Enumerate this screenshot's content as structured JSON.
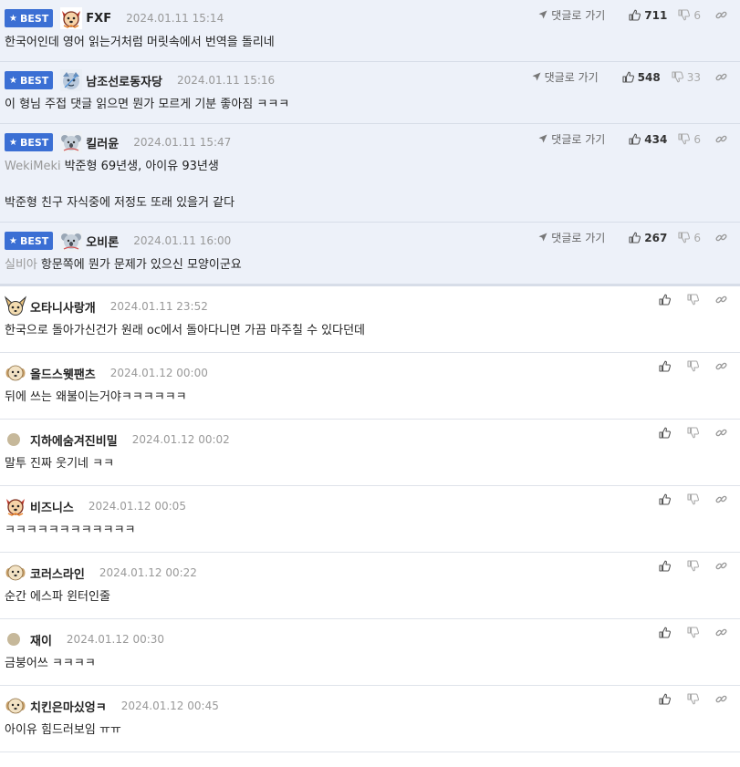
{
  "labels": {
    "best": "BEST",
    "reply": "댓글로 가기"
  },
  "best_comments": [
    {
      "nick": "FXF",
      "date": "2024.01.11 15:14",
      "likes": "711",
      "dislikes": "6",
      "avatar": "red-dog",
      "prefix": "",
      "lines": [
        "한국어인데 영어 읽는거처럼 머릿속에서 번역을 돌리네"
      ]
    },
    {
      "nick": "남조선로동자당",
      "date": "2024.01.11 15:16",
      "likes": "548",
      "dislikes": "33",
      "avatar": "blue-face",
      "prefix": "",
      "lines": [
        "이 형님 주접 댓글 읽으면 뭔가 모르게 기분 좋아짐 ㅋㅋㅋ"
      ]
    },
    {
      "nick": "킬러윤",
      "date": "2024.01.11 15:47",
      "likes": "434",
      "dislikes": "6",
      "avatar": "koala",
      "prefix": "WekiMeki",
      "lines": [
        "박준형 69년생, 아이유 93년생",
        "",
        "박준형 친구 자식중에 저정도 또래 있을거 같다"
      ]
    },
    {
      "nick": "오비론",
      "date": "2024.01.11 16:00",
      "likes": "267",
      "dislikes": "6",
      "avatar": "koala",
      "prefix": "실비아",
      "lines": [
        "항문쪽에 뭔가 문제가 있으신 모양이군요"
      ]
    }
  ],
  "comments": [
    {
      "nick": "오타니사랑개",
      "date": "2024.01.11 23:52",
      "avatar": "chihuahua",
      "text": "한국으로 돌아가신건가 원래 oc에서 돌아다니면 가끔 마주칠 수 있다던데"
    },
    {
      "nick": "올드스웻팬츠",
      "date": "2024.01.12 00:00",
      "avatar": "puppy",
      "text": "뒤에 쓰는 왜불이는거야ㅋㅋㅋㅋㅋㅋ"
    },
    {
      "nick": "지하에숨겨진비밀",
      "date": "2024.01.12 00:02",
      "avatar": "dot",
      "text": "말투 진짜 웃기네 ㅋㅋ"
    },
    {
      "nick": "비즈니스",
      "date": "2024.01.12 00:05",
      "avatar": "red-dog",
      "text": "ㅋㅋㅋㅋㅋㅋㅋㅋㅋㅋㅋㅋ"
    },
    {
      "nick": "코러스라인",
      "date": "2024.01.12 00:22",
      "avatar": "puppy",
      "text": "순간 에스파 윈터인줄"
    },
    {
      "nick": "재이",
      "date": "2024.01.12 00:30",
      "avatar": "dot",
      "text": "금붕어쓰 ㅋㅋㅋㅋ"
    },
    {
      "nick": "치킨은마싰엉ㅋ",
      "date": "2024.01.12 00:45",
      "avatar": "puppy",
      "text": "아이유 힘드러보임 ㅠㅠ"
    }
  ],
  "colors": {
    "best_bg": "#edf1f9",
    "badge": "#3b6fd4"
  }
}
